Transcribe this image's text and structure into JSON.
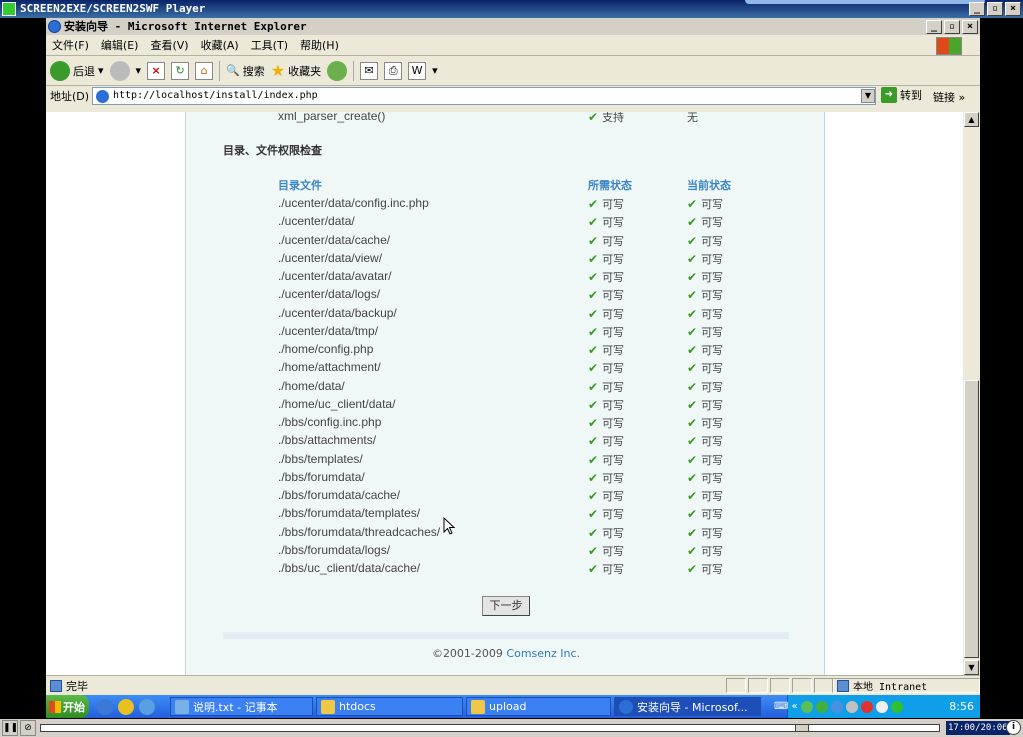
{
  "player": {
    "title": "SCREEN2EXE/SCREEN2SWF Player",
    "time": "17:00/20:06",
    "progress_fraction": 0.846
  },
  "browser": {
    "title": "安装向导 - Microsoft Internet Explorer",
    "menu": [
      "文件(F)",
      "编辑(E)",
      "查看(V)",
      "收藏(A)",
      "工具(T)",
      "帮助(H)"
    ],
    "toolbar": {
      "back_label": "后退",
      "search_label": "搜索",
      "favorites_label": "收藏夹"
    },
    "address_label": "地址(D)",
    "address_value": "http://localhost/install/index.php",
    "go_label": "转到",
    "links_label": "链接 »",
    "status_text": "完毕",
    "zone_text": "本地 Intranet"
  },
  "page": {
    "top_partial": {
      "name": "xml_parser_create()",
      "required": "支持",
      "current": "无"
    },
    "section_title": "目录、文件权限检查",
    "columns": {
      "file": "目录文件",
      "required": "所需状态",
      "current": "当前状态"
    },
    "rows": [
      {
        "file": "./ucenter/data/config.inc.php",
        "required": "可写",
        "current": "可写"
      },
      {
        "file": "./ucenter/data/",
        "required": "可写",
        "current": "可写"
      },
      {
        "file": "./ucenter/data/cache/",
        "required": "可写",
        "current": "可写"
      },
      {
        "file": "./ucenter/data/view/",
        "required": "可写",
        "current": "可写"
      },
      {
        "file": "./ucenter/data/avatar/",
        "required": "可写",
        "current": "可写"
      },
      {
        "file": "./ucenter/data/logs/",
        "required": "可写",
        "current": "可写"
      },
      {
        "file": "./ucenter/data/backup/",
        "required": "可写",
        "current": "可写"
      },
      {
        "file": "./ucenter/data/tmp/",
        "required": "可写",
        "current": "可写"
      },
      {
        "file": "./home/config.php",
        "required": "可写",
        "current": "可写"
      },
      {
        "file": "./home/attachment/",
        "required": "可写",
        "current": "可写"
      },
      {
        "file": "./home/data/",
        "required": "可写",
        "current": "可写"
      },
      {
        "file": "./home/uc_client/data/",
        "required": "可写",
        "current": "可写"
      },
      {
        "file": "./bbs/config.inc.php",
        "required": "可写",
        "current": "可写"
      },
      {
        "file": "./bbs/attachments/",
        "required": "可写",
        "current": "可写"
      },
      {
        "file": "./bbs/templates/",
        "required": "可写",
        "current": "可写"
      },
      {
        "file": "./bbs/forumdata/",
        "required": "可写",
        "current": "可写"
      },
      {
        "file": "./bbs/forumdata/cache/",
        "required": "可写",
        "current": "可写"
      },
      {
        "file": "./bbs/forumdata/templates/",
        "required": "可写",
        "current": "可写"
      },
      {
        "file": "./bbs/forumdata/threadcaches/",
        "required": "可写",
        "current": "可写"
      },
      {
        "file": "./bbs/forumdata/logs/",
        "required": "可写",
        "current": "可写"
      },
      {
        "file": "./bbs/uc_client/data/cache/",
        "required": "可写",
        "current": "可写"
      }
    ],
    "next_button": "下一步",
    "footer_copyright": "©2001-2009",
    "footer_company": "Comsenz Inc."
  },
  "taskbar": {
    "start_label": "开始",
    "tasks": [
      {
        "label": "说明.txt - 记事本"
      },
      {
        "label": "htdocs"
      },
      {
        "label": "upload"
      },
      {
        "label": "安装向导 - Microsof..."
      }
    ],
    "clock": "8:56"
  },
  "colors": {
    "accent_blue": "#3b87c6",
    "check_green": "#3a9a1f",
    "page_bg": "#f0f7f7"
  }
}
